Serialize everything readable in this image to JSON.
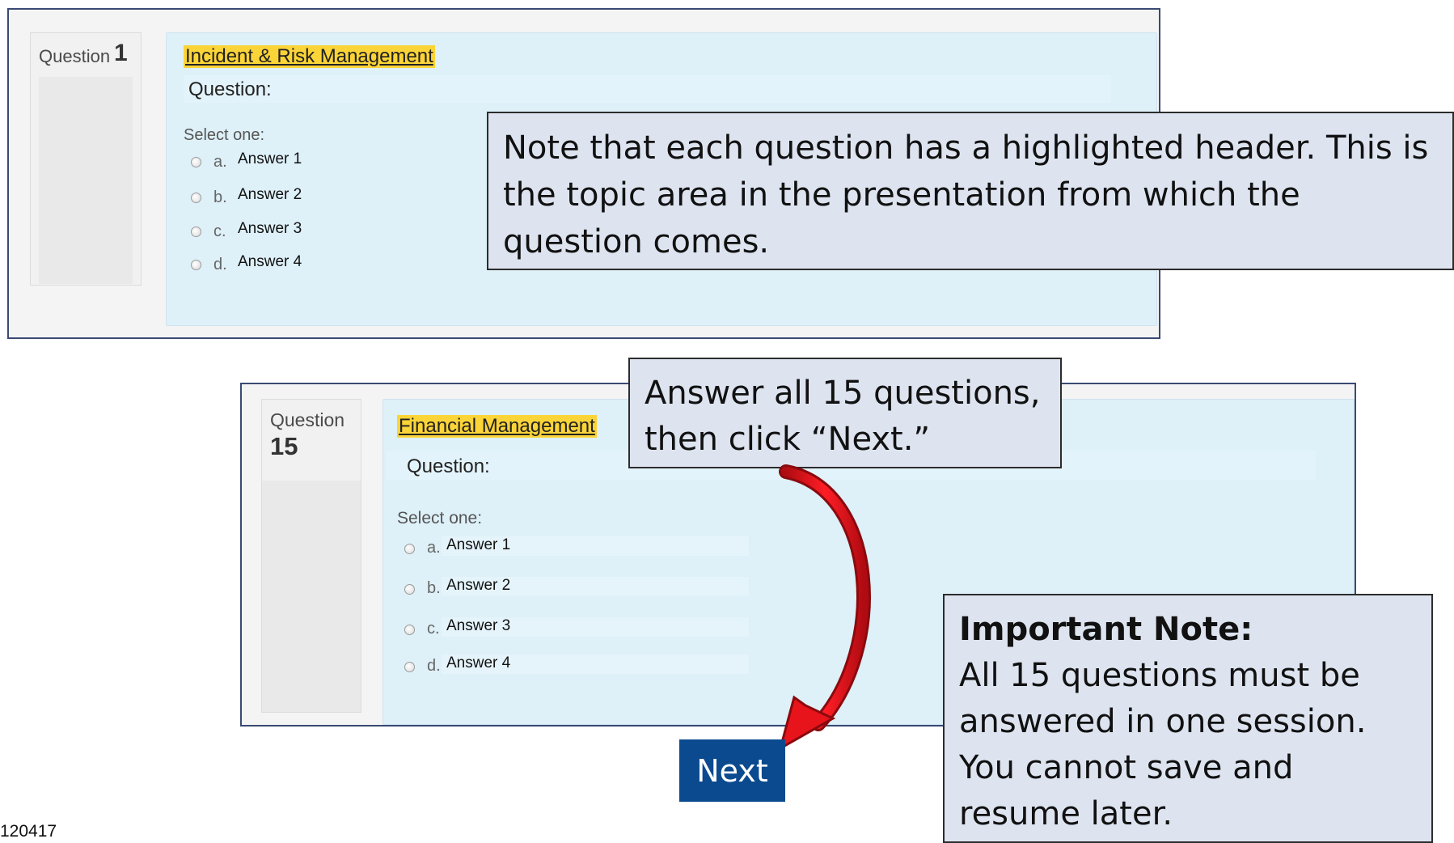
{
  "screen1": {
    "question_label": "Question",
    "question_number": "1",
    "topic": "Incident & Risk Management",
    "question_text": "Question:",
    "select_one": "Select one:",
    "answers": [
      {
        "letter": "a.",
        "text": "Answer 1"
      },
      {
        "letter": "b.",
        "text": "Answer 2"
      },
      {
        "letter": "c.",
        "text": "Answer 3"
      },
      {
        "letter": "d.",
        "text": "Answer 4"
      }
    ]
  },
  "screen2": {
    "question_label": "Question",
    "question_number": "15",
    "topic": "Financial Management",
    "question_text": "Question:",
    "select_one": "Select one:",
    "answers": [
      {
        "letter": "a.",
        "text": "Answer 1"
      },
      {
        "letter": "b.",
        "text": "Answer 2"
      },
      {
        "letter": "c.",
        "text": "Answer 3"
      },
      {
        "letter": "d.",
        "text": "Answer 4"
      }
    ]
  },
  "callouts": {
    "header_note": "Note that each question has a highlighted header. This is the topic area in the presentation from which the question comes.",
    "answer_all": "Answer all 15 questions, then click “Next.”",
    "important_title": "Important Note:",
    "important_body": "All 15 questions must be answered in one session. You cannot save and resume later."
  },
  "next_button": {
    "label": "Next"
  },
  "footer_code": "120417",
  "colors": {
    "topic_highlight": "#fbd437",
    "arrow": "#e8141b",
    "next_button": "#0b4a8f",
    "callout_bg": "#dde4f0"
  }
}
